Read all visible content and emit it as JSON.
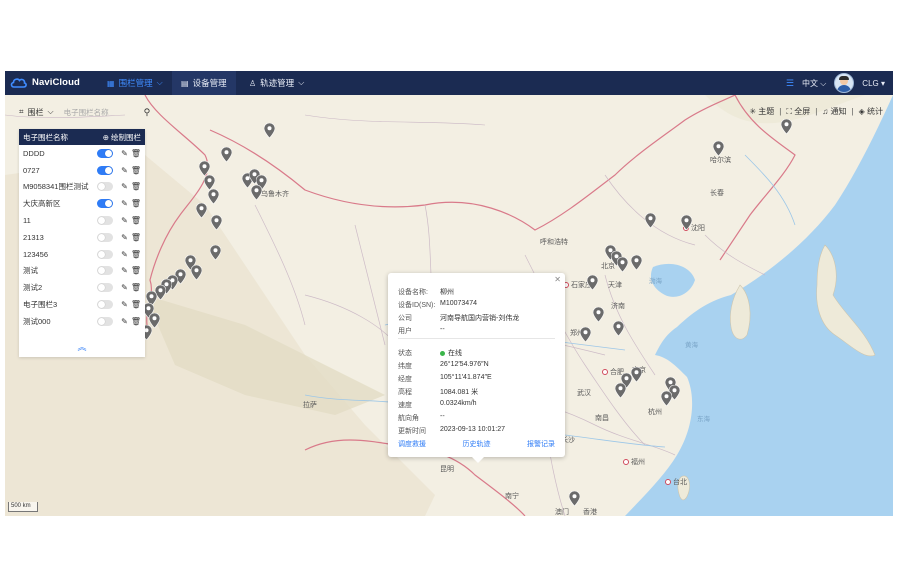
{
  "navbar": {
    "brand": "NaviCloud",
    "menu": [
      {
        "label": "围栏管理",
        "active": true
      },
      {
        "label": "设备管理",
        "active": false
      },
      {
        "label": "轨迹管理",
        "active": false
      }
    ],
    "language": "中文",
    "user": "CLG"
  },
  "search": {
    "type_label": "围栏",
    "placeholder": "电子围栏名称"
  },
  "tools": {
    "theme": "主题",
    "fullscreen": "全屏",
    "notify": "通知",
    "stats": "统计"
  },
  "panel": {
    "header": "电子围栏名称",
    "draw_label": "绘制围栏",
    "fences": [
      {
        "name": "DDDD",
        "on": true
      },
      {
        "name": "0727",
        "on": true
      },
      {
        "name": "M9058341围栏测试",
        "on": false
      },
      {
        "name": "大庆高新区",
        "on": true
      },
      {
        "name": "11",
        "on": false
      },
      {
        "name": "21313",
        "on": false
      },
      {
        "name": "123456",
        "on": false
      },
      {
        "name": "测试",
        "on": false
      },
      {
        "name": "测试2",
        "on": false
      },
      {
        "name": "电子围栏3",
        "on": false
      },
      {
        "name": "测试000",
        "on": false
      }
    ]
  },
  "popup": {
    "device_name_k": "设备名称:",
    "device_name": "柳州",
    "device_id_k": "设备ID(SN):",
    "device_id": "M10073474",
    "company_k": "公司",
    "company": "河南导航国内营销-刘伟龙",
    "user_k": "用户",
    "user": "--",
    "status_k": "状态",
    "status": "在线",
    "lat_k": "纬度",
    "lat": "26°12′54.976″N",
    "lng_k": "经度",
    "lng": "105°11′41.874″E",
    "alt_k": "高程",
    "alt": "1084.081 米",
    "speed_k": "速度",
    "speed": "0.0324km/h",
    "heading_k": "航向角",
    "heading": "--",
    "updated_k": "更新时间",
    "updated": "2023-09-13 10:01:27",
    "link_remote": "调度救援",
    "link_history": "历史轨迹",
    "link_alarm": "报警记录"
  },
  "map": {
    "places": [
      {
        "name": "乌鲁木齐",
        "sea": false
      },
      {
        "name": "哈尔滨",
        "sea": false
      },
      {
        "name": "长春",
        "sea": false
      },
      {
        "name": "沈阳",
        "sea": false
      },
      {
        "name": "呼和浩特",
        "sea": false
      },
      {
        "name": "北京",
        "sea": false
      },
      {
        "name": "天津",
        "sea": false
      },
      {
        "name": "石家庄",
        "sea": false
      },
      {
        "name": "济南",
        "sea": false
      },
      {
        "name": "郑州",
        "sea": false
      },
      {
        "name": "南京",
        "sea": false
      },
      {
        "name": "合肥",
        "sea": false
      },
      {
        "name": "杭州",
        "sea": false
      },
      {
        "name": "武汉",
        "sea": false
      },
      {
        "name": "南昌",
        "sea": false
      },
      {
        "name": "长沙",
        "sea": false
      },
      {
        "name": "福州",
        "sea": false
      },
      {
        "name": "贵阳",
        "sea": false
      },
      {
        "name": "昆明",
        "sea": false
      },
      {
        "name": "南宁",
        "sea": false
      },
      {
        "name": "拉萨",
        "sea": false
      },
      {
        "name": "台北",
        "sea": false
      },
      {
        "name": "澳门",
        "sea": false
      },
      {
        "name": "香港",
        "sea": false
      },
      {
        "name": "渤海",
        "sea": true
      },
      {
        "name": "黄海",
        "sea": true
      },
      {
        "name": "东海",
        "sea": true
      }
    ],
    "scale": "500 km"
  },
  "colors": {
    "navbar": "#1b2b52",
    "accent": "#2f7cf6",
    "online": "#3bb54a",
    "pin": "#6b6b6b"
  }
}
